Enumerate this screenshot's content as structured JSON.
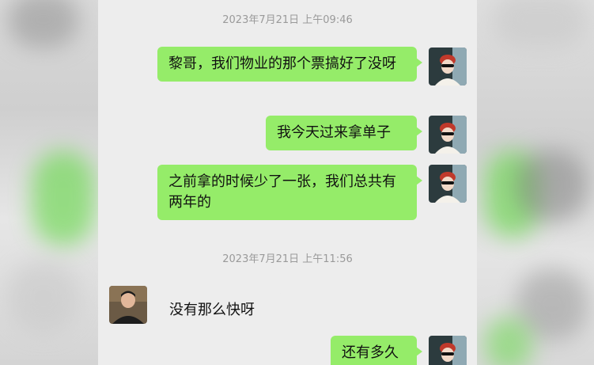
{
  "messages": [
    {
      "timestamp": "2023年7月21日 上午09:46"
    },
    {
      "text": "黎哥，我们物业的那个票搞好了没呀"
    },
    {
      "text": "我今天过来拿单子"
    },
    {
      "text": "之前拿的时候少了一张，我们总共有两年的"
    },
    {
      "timestamp": "2023年7月21日 上午11:56"
    },
    {
      "text": "没有那么快呀"
    },
    {
      "text": "还有多久"
    }
  ],
  "colors": {
    "my_bubble": "#95ec69",
    "chat_bg": "#ededed"
  }
}
